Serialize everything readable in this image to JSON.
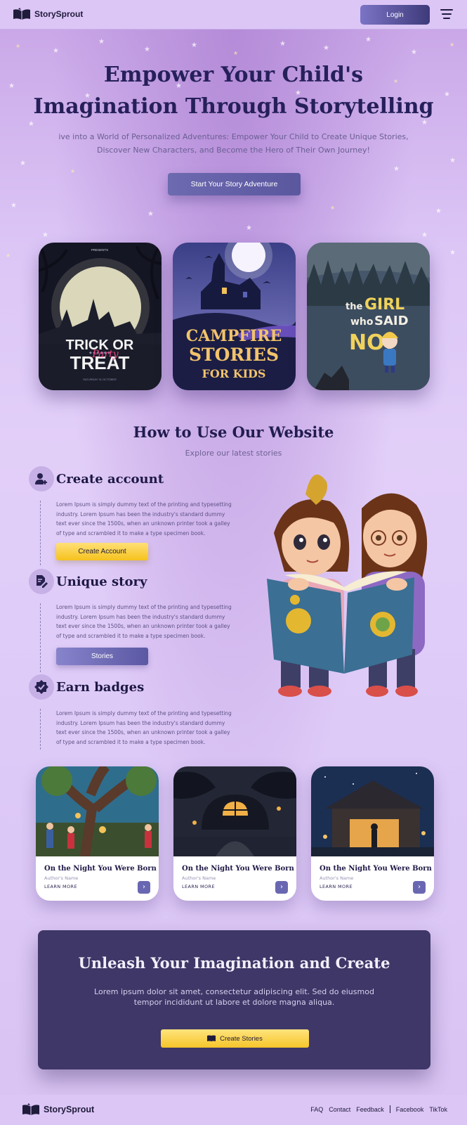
{
  "nav": {
    "brand": "StorySprout",
    "login_label": "Login"
  },
  "hero": {
    "title_line1": "Empower Your Child's",
    "title_line2": "Imagination Through Storytelling",
    "subtitle": "ive into a World of Personalized Adventures: Empower Your Child to Create Unique Stories, Discover New Characters, and Become the Hero of Their Own Journey!",
    "cta_label": "Start Your Story Adventure"
  },
  "covers": [
    {
      "kind": "trick-or-treat",
      "title": "TRICK OR TREAT",
      "script": "Party"
    },
    {
      "kind": "campfire",
      "title": "CAMPFIRE STORIES FOR KIDS"
    },
    {
      "kind": "girl",
      "title": "the GIRL who SAID NO!"
    }
  ],
  "how_to": {
    "title": "How to Use Our Website",
    "subtitle": "Explore our latest stories",
    "steps": [
      {
        "icon": "user-plus-icon",
        "title": "Create account",
        "text": "Lorem Ipsum is simply dummy text of the printing and typesetting industry. Lorem Ipsum has been the industry's standard dummy text ever since the 1500s, when an unknown printer took a galley of type and scrambled it to make a type specimen book.",
        "button": "Create Account"
      },
      {
        "icon": "edit-document-icon",
        "title": "Unique story",
        "text": "Lorem Ipsum is simply dummy text of the printing and typesetting industry. Lorem Ipsum has been the industry's standard dummy text ever since the 1500s, when an unknown printer took a galley of type and scrambled it to make a type specimen book.",
        "button": "Stories"
      },
      {
        "icon": "badge-check-icon",
        "title": "Earn badges",
        "text": "Lorem Ipsum is simply dummy text of the printing and typesetting industry. Lorem Ipsum has been the industry's standard dummy text ever since the 1500s, when an unknown printer took a galley of type and scrambled it to make a type specimen book."
      }
    ]
  },
  "stories": [
    {
      "title": "On the Night You Were Born",
      "author": "Author's Name",
      "more": "LEARN MORE"
    },
    {
      "title": "On the Night You Were Born",
      "author": "Author's Name",
      "more": "LEARN MORE"
    },
    {
      "title": "On the Night You Were Born",
      "author": "Author's Name",
      "more": "LEARN MORE"
    }
  ],
  "banner": {
    "title": "Unleash Your Imagination and Create",
    "text": "Lorem ipsum dolor sit amet, consectetur adipiscing elit. Sed do eiusmod tempor incididunt ut labore et dolore magna aliqua.",
    "button": "Create Stories"
  },
  "footer": {
    "brand": "StorySprout",
    "links": [
      "FAQ",
      "Contact",
      "Feedback",
      "Facebook",
      "TikTok"
    ]
  },
  "colors": {
    "accent": "#3e3767",
    "button_yellow": "#f6c21d",
    "button_purple": "#5b58a3"
  }
}
